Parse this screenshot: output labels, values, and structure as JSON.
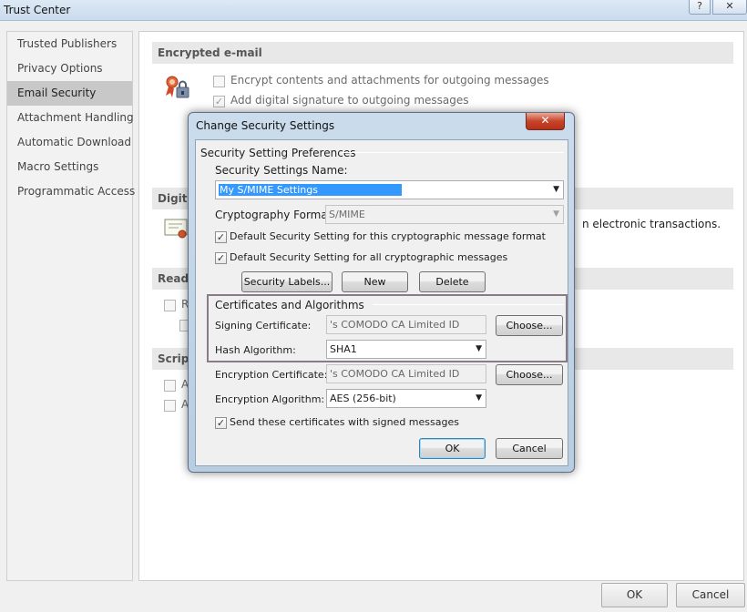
{
  "window": {
    "title": "Trust Center",
    "help_glyph": "?",
    "close_glyph": "✕"
  },
  "sidebar": {
    "items": [
      {
        "label": "Trusted Publishers"
      },
      {
        "label": "Privacy Options"
      },
      {
        "label": "Email Security",
        "selected": true
      },
      {
        "label": "Attachment Handling"
      },
      {
        "label": "Automatic Download"
      },
      {
        "label": "Macro Settings"
      },
      {
        "label": "Programmatic Access"
      }
    ]
  },
  "content": {
    "encrypted_header": "Encrypted e-mail",
    "encrypt_label": "Encrypt contents and attachments for outgoing messages",
    "signature_label": "Add digital signature to outgoing messages",
    "digital_header": "Digita",
    "digital_text": "n electronic transactions.",
    "read_header": "Read a",
    "read_frag": "R",
    "script_header": "Script",
    "script_frag_1": "A",
    "script_frag_2": "A"
  },
  "footer": {
    "ok": "OK",
    "cancel": "Cancel"
  },
  "dialog": {
    "title": "Change Security Settings",
    "close_glyph": "✕",
    "prefs_group": "Security Setting Preferences",
    "name_label": "Security Settings Name:",
    "name_value": "My S/MIME Settings",
    "crypto_label": "Cryptography Format:",
    "crypto_value": "S/MIME",
    "default_format_label": "Default Security Setting for this cryptographic message format",
    "default_all_label": "Default Security Setting for all cryptographic messages",
    "security_labels_btn": "Security Labels...",
    "new_btn": "New",
    "delete_btn": "Delete",
    "cert_group": "Certificates and Algorithms",
    "signing_cert_label": "Signing Certificate:",
    "signing_cert_value": "'s COMODO CA Limited ID",
    "choose_btn_1": "Choose...",
    "hash_label": "Hash Algorithm:",
    "hash_value": "SHA1",
    "enc_cert_label": "Encryption Certificate:",
    "enc_cert_value": "'s COMODO CA Limited ID",
    "choose_btn_2": "Choose...",
    "enc_alg_label": "Encryption Algorithm:",
    "enc_alg_value": "AES (256-bit)",
    "send_certs_label": "Send these certificates with signed messages",
    "ok_btn": "OK",
    "cancel_btn": "Cancel",
    "dropdown_glyph": "▼"
  },
  "colors": {
    "selected_item_bg": "#c8c8c8",
    "selection_highlight": "#3399ff",
    "dialog_frame": "#b8cde2",
    "close_button": "#c7442b"
  }
}
